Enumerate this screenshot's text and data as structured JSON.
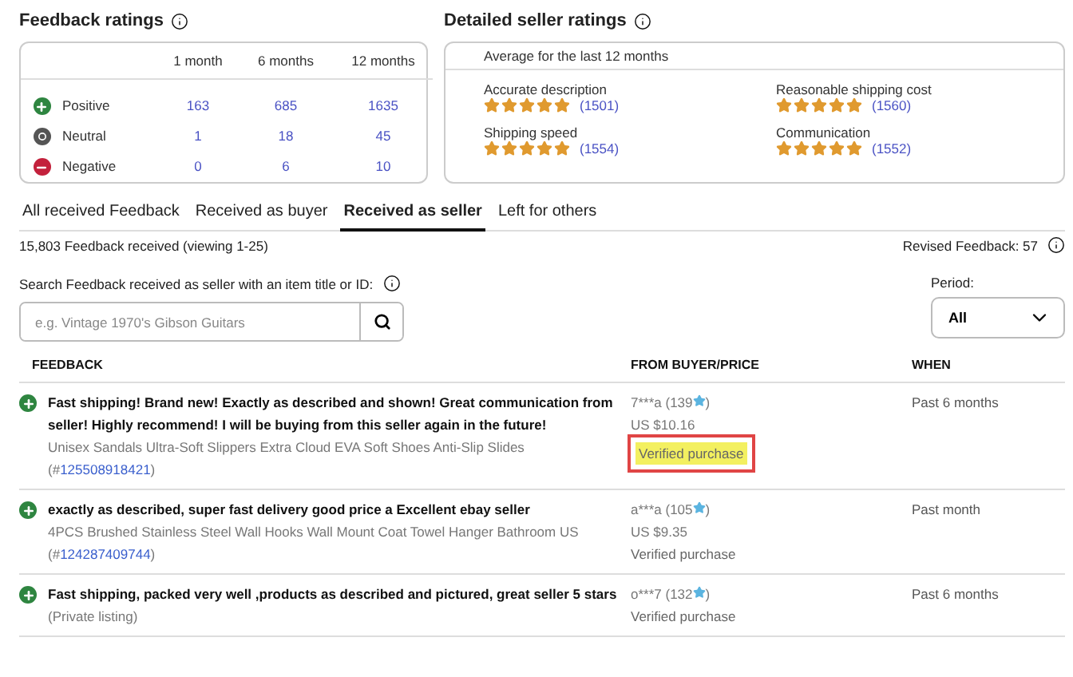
{
  "feedback_ratings": {
    "title": "Feedback ratings",
    "columns": [
      "1 month",
      "6 months",
      "12 months"
    ],
    "rows": [
      {
        "kind": "positive",
        "label": "Positive",
        "values": [
          "163",
          "685",
          "1635"
        ]
      },
      {
        "kind": "neutral",
        "label": "Neutral",
        "values": [
          "1",
          "18",
          "45"
        ]
      },
      {
        "kind": "negative",
        "label": "Negative",
        "values": [
          "0",
          "6",
          "10"
        ]
      }
    ]
  },
  "detailed_seller_ratings": {
    "title": "Detailed seller ratings",
    "subtitle": "Average for the last 12 months",
    "items": [
      {
        "label": "Accurate description",
        "stars": 5,
        "count": "(1501)"
      },
      {
        "label": "Reasonable shipping cost",
        "stars": 5,
        "count": "(1560)"
      },
      {
        "label": "Shipping speed",
        "stars": 5,
        "count": "(1554)"
      },
      {
        "label": "Communication",
        "stars": 5,
        "count": "(1552)"
      }
    ]
  },
  "tabs": [
    {
      "label": "All received Feedback",
      "selected": false
    },
    {
      "label": "Received as buyer",
      "selected": false
    },
    {
      "label": "Received as seller",
      "selected": true
    },
    {
      "label": "Left for others",
      "selected": false
    }
  ],
  "summary": "15,803 Feedback received (viewing 1-25)",
  "revised": "Revised Feedback: 57",
  "search": {
    "label": "Search Feedback received as seller with an item title or ID:",
    "placeholder": "e.g. Vintage 1970's Gibson Guitars"
  },
  "period": {
    "label": "Period:",
    "value": "All"
  },
  "table": {
    "columns": [
      "FEEDBACK",
      "FROM BUYER/PRICE",
      "WHEN"
    ],
    "rows": [
      {
        "kind": "positive",
        "comment": "Fast shipping! Brand new! Exactly as described and shown! Great communication from seller! Highly recommend! I will be buying from this seller again in the future!",
        "item": "Unisex Sandals Ultra-Soft Slippers Extra Cloud EVA Soft Shoes Anti-Slip Slides",
        "item_ref": {
          "before": "(#",
          "link": "125508918421",
          "after": ")"
        },
        "buyer": "7***a (139",
        "buyer_end": ")",
        "price": "US $10.16",
        "verified": "Verified purchase",
        "highlighted": true,
        "when": "Past 6 months"
      },
      {
        "kind": "positive",
        "comment": "exactly as described, super fast delivery good price a Excellent ebay seller",
        "item": "4PCS Brushed Stainless Steel Wall Hooks Wall Mount Coat Towel Hanger Bathroom US",
        "item_ref": {
          "before": "(#",
          "link": "124287409744",
          "after": ")"
        },
        "buyer": "a***a (105",
        "buyer_end": ")",
        "price": "US $9.35",
        "verified": "Verified purchase",
        "highlighted": false,
        "when": "Past month"
      },
      {
        "kind": "positive",
        "comment": "Fast shipping, packed very well ,products as described and pictured, great seller 5 stars",
        "item": "(Private listing)",
        "buyer": "o***7 (132",
        "buyer_end": ")",
        "verified": "Verified purchase",
        "highlighted": false,
        "when": "Past 6 months"
      }
    ]
  }
}
